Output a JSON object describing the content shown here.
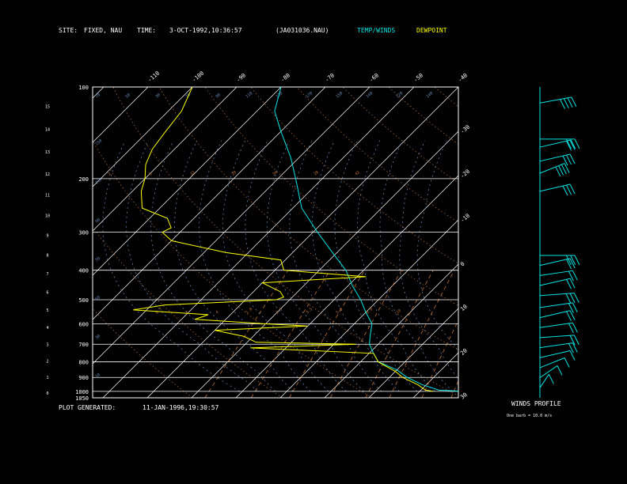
{
  "header": {
    "site_label": "SITE:",
    "site_value": "FIXED, NAU",
    "time_label": "TIME:",
    "time_value": "3-OCT-1992,10:36:57",
    "file_value": "(JA031036.NAU)",
    "temp_label": "TEMP/WINDS",
    "dew_label": "DEWPOINT"
  },
  "footer": {
    "generated_label": "PLOT GENERATED:",
    "generated_value": "11-JAN-1996,19:30:57",
    "winds_profile_label": "WINDS PROFILE",
    "barb_note": "One barb = 10.0 m/s"
  },
  "colors": {
    "background": "#000000",
    "temp": "#00e5e5",
    "dewpoint": "#ffff00",
    "frame": "#ffffff",
    "isotherm": "#ffffff",
    "dry_adiabat": "#c07030",
    "moist_adiabat": "#6a90c0",
    "mixing_ratio": "#c07030"
  },
  "chart_data": {
    "type": "line",
    "subtype": "skew-T log-P thermodynamic diagram",
    "pressure_ticks": [
      "100",
      "200",
      "300",
      "400",
      "500",
      "600",
      "700",
      "800",
      "900",
      "1000",
      "1050"
    ],
    "height_ticks": [
      "15",
      "14",
      "13",
      "12",
      "11",
      "10",
      "9",
      "8",
      "7",
      "6",
      "5",
      "4",
      "3",
      "2",
      "1",
      "0"
    ],
    "top_temp_ticks": [
      "-110",
      "-100",
      "-90",
      "-80",
      "-70",
      "-60",
      "-50",
      "-40"
    ],
    "right_temp_ticks": [
      "-30",
      "-20",
      "-10",
      "0",
      "10",
      "20",
      "30"
    ],
    "isotherm_step": 10,
    "theta_labels": [
      "70",
      "50",
      "30",
      "70",
      "90",
      "110",
      "130",
      "170",
      "150",
      "140",
      "120",
      "140",
      "150",
      "110",
      "90",
      "70",
      "50",
      "30",
      "10"
    ],
    "mixing_ratio_labels": [
      "2",
      "6",
      "12",
      "20",
      "34",
      "28",
      "42"
    ],
    "mixing_ratio_lower_labels": [
      "0.7",
      "2",
      "4",
      "1.0",
      "2.5",
      "3.5",
      "5.0",
      "8.0",
      "10"
    ],
    "series": [
      {
        "name": "TEMP/WINDS",
        "points_p_t": [
          [
            1000,
            30
          ],
          [
            990,
            24
          ],
          [
            950,
            19
          ],
          [
            900,
            14
          ],
          [
            850,
            10
          ],
          [
            800,
            4
          ],
          [
            750,
            1
          ],
          [
            700,
            -2
          ],
          [
            650,
            -4
          ],
          [
            600,
            -6
          ],
          [
            550,
            -10
          ],
          [
            500,
            -14
          ],
          [
            450,
            -19
          ],
          [
            400,
            -24
          ],
          [
            350,
            -31
          ],
          [
            300,
            -39
          ],
          [
            250,
            -48
          ],
          [
            200,
            -56
          ],
          [
            170,
            -62
          ],
          [
            140,
            -70
          ],
          [
            120,
            -76
          ],
          [
            100,
            -80
          ]
        ]
      },
      {
        "name": "DEWPOINT",
        "points_p_t": [
          [
            1000,
            23
          ],
          [
            990,
            21
          ],
          [
            950,
            18
          ],
          [
            900,
            13
          ],
          [
            860,
            10
          ],
          [
            820,
            6
          ],
          [
            800,
            4
          ],
          [
            750,
            1
          ],
          [
            720,
            -28
          ],
          [
            700,
            -5
          ],
          [
            690,
            -28
          ],
          [
            660,
            -32
          ],
          [
            630,
            -40
          ],
          [
            610,
            -20
          ],
          [
            600,
            -30
          ],
          [
            580,
            -47
          ],
          [
            560,
            -45
          ],
          [
            540,
            -63
          ],
          [
            520,
            -57
          ],
          [
            500,
            -33
          ],
          [
            490,
            -32
          ],
          [
            470,
            -34
          ],
          [
            440,
            -40
          ],
          [
            420,
            -18
          ],
          [
            400,
            -38
          ],
          [
            370,
            -41
          ],
          [
            350,
            -55
          ],
          [
            320,
            -70
          ],
          [
            300,
            -74
          ],
          [
            290,
            -73
          ],
          [
            270,
            -76
          ],
          [
            250,
            -84
          ],
          [
            220,
            -88
          ],
          [
            200,
            -90
          ],
          [
            180,
            -93
          ],
          [
            160,
            -95
          ],
          [
            140,
            -96
          ],
          [
            120,
            -97
          ],
          [
            100,
            -100
          ]
        ]
      }
    ],
    "wind_profile": {
      "barb_unit_ms": 10,
      "levels_km": [
        14.7,
        12.9,
        12.5,
        11.8,
        11.2,
        10.3,
        7.1,
        6.6,
        6.1,
        5.6,
        5.1,
        4.5,
        4.0,
        3.5,
        3.0,
        2.5,
        2.0,
        1.5,
        1.0,
        0.5
      ],
      "direction_deg": [
        245,
        270,
        240,
        300,
        315,
        300,
        270,
        300,
        290,
        300,
        280,
        290,
        300,
        290,
        280,
        290,
        300,
        315,
        330,
        345
      ],
      "speed_ms": [
        35,
        25,
        15,
        28,
        42,
        30,
        26,
        22,
        20,
        18,
        25,
        18,
        15,
        18,
        22,
        15,
        12,
        10,
        8,
        6
      ]
    }
  }
}
